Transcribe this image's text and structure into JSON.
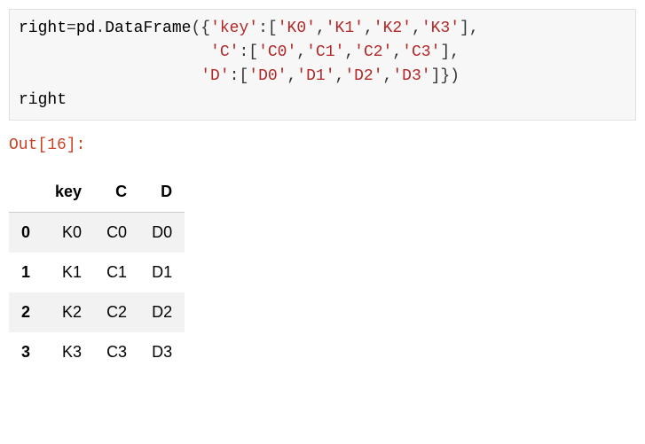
{
  "code": {
    "line1_pre": "right",
    "line1_eq": "=",
    "line1_pd": "pd",
    "line1_dot": ".",
    "line1_fn": "DataFrame",
    "line1_open": "({",
    "key_str": "'key'",
    "colon": ":",
    "lbr": "[",
    "rbr": "]",
    "comma": ",",
    "k0": "'K0'",
    "k1": "'K1'",
    "k2": "'K2'",
    "k3": "'K3'",
    "c_key": "'C'",
    "c0": "'C0'",
    "c1": "'C1'",
    "c2": "'C2'",
    "c3": "'C3'",
    "d_key": "'D'",
    "d0": "'D0'",
    "d1": "'D1'",
    "d2": "'D2'",
    "d3": "'D3'",
    "close": "]})",
    "line4": "right",
    "indent2": "                    ",
    "indent3": "                   "
  },
  "out_label": "Out[16]:",
  "chart_data": {
    "type": "table",
    "columns": [
      "key",
      "C",
      "D"
    ],
    "index": [
      "0",
      "1",
      "2",
      "3"
    ],
    "rows": [
      [
        "K0",
        "C0",
        "D0"
      ],
      [
        "K1",
        "C1",
        "D1"
      ],
      [
        "K2",
        "C2",
        "D2"
      ],
      [
        "K3",
        "C3",
        "D3"
      ]
    ]
  }
}
